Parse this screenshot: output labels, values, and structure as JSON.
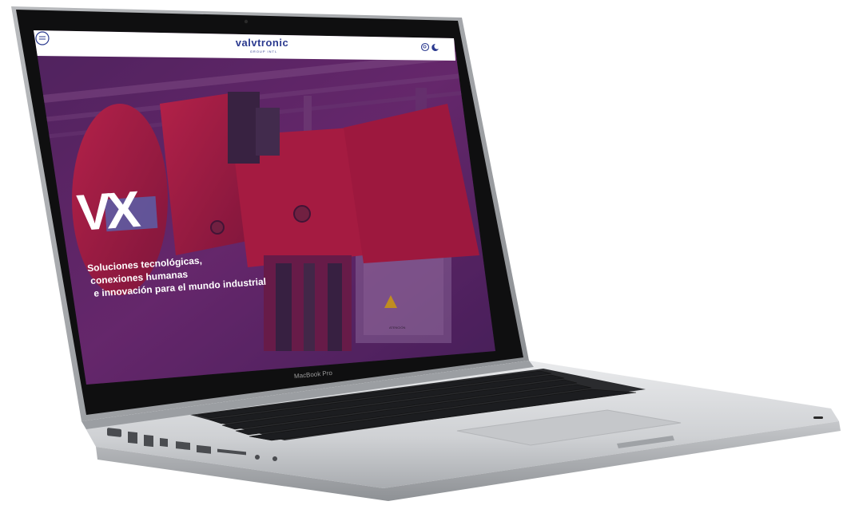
{
  "device": {
    "model_label": "MacBook Pro"
  },
  "site": {
    "logo_text": "valvtronic",
    "logo_tagline": "GROUP INTL",
    "hero_mark": "VX",
    "hero_lines": [
      "Soluciones tecnológicas,",
      "conexiones humanas",
      "e innovación para el mundo industrial"
    ],
    "warning_label": "ATENCIÓN"
  },
  "colors": {
    "brand_blue": "#2b3a8f",
    "overlay": "#5a1f6e",
    "machine_red": "#c0182a",
    "aluminum": "#d4d6d9",
    "bezel": "#111111"
  },
  "icons": [
    "menu-icon",
    "search-icon",
    "dark-mode-icon"
  ]
}
